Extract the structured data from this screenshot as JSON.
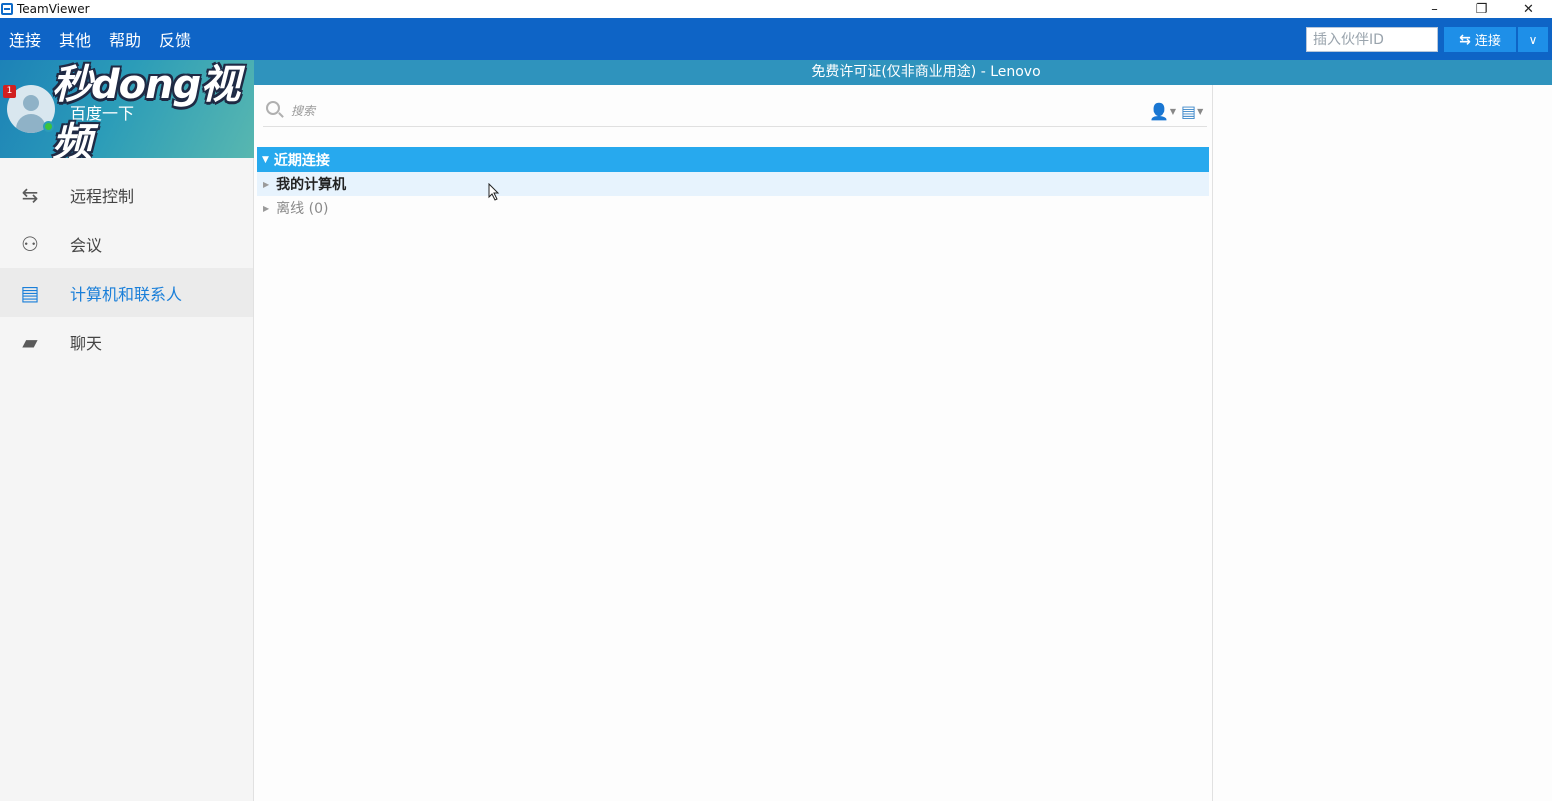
{
  "window": {
    "title": "TeamViewer",
    "minimize_glyph": "–",
    "restore_glyph": "❐",
    "close_glyph": "✕"
  },
  "menu": [
    "连接",
    "其他",
    "帮助",
    "反馈"
  ],
  "partner_id": {
    "placeholder": "插入伙伴ID",
    "value": ""
  },
  "connect_button": {
    "label": "连接",
    "dropdown_glyph": "∨"
  },
  "license_text": "免费许可证(仅非商业用途) - Lenovo",
  "profile": {
    "username": "百度一下",
    "notification_count": "1",
    "watermark": "秒dong视频",
    "status_color": "#3cc43c"
  },
  "nav": [
    {
      "id": "remote",
      "label": "远程控制",
      "icon": "arrows-icon",
      "glyph": "⇆"
    },
    {
      "id": "meeting",
      "label": "会议",
      "icon": "meeting-icon",
      "glyph": "⚇"
    },
    {
      "id": "contacts",
      "label": "计算机和联系人",
      "icon": "contacts-icon",
      "glyph": "▤",
      "active": true
    },
    {
      "id": "chat",
      "label": "聊天",
      "icon": "chat-icon",
      "glyph": "▰"
    }
  ],
  "search": {
    "placeholder": "搜索",
    "value": ""
  },
  "tree": {
    "group_label": "近期连接",
    "rows": [
      {
        "label": "我的计算机",
        "style": "bold"
      },
      {
        "label": "离线 (0)",
        "style": "muted"
      }
    ]
  },
  "colors": {
    "menubar": "#0e64c6",
    "license_bar": "#2f93bd",
    "accent": "#1a7fd9",
    "group_header": "#27a9ee"
  }
}
